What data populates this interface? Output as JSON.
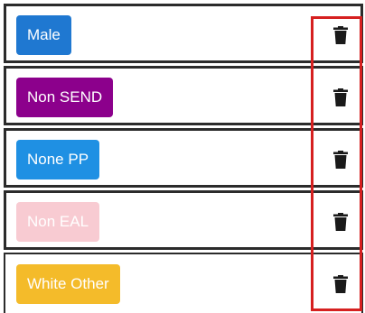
{
  "tags": [
    {
      "label": "Male",
      "color": "#1f78d1"
    },
    {
      "label": "Non SEND",
      "color": "#8c008c"
    },
    {
      "label": "None PP",
      "color": "#1f90e3"
    },
    {
      "label": "Non EAL",
      "color": "#f8cbd2"
    },
    {
      "label": "White Other",
      "color": "#f4bb2a"
    }
  ],
  "icons": {
    "delete": "trash-icon"
  },
  "highlight_color": "#d62020"
}
